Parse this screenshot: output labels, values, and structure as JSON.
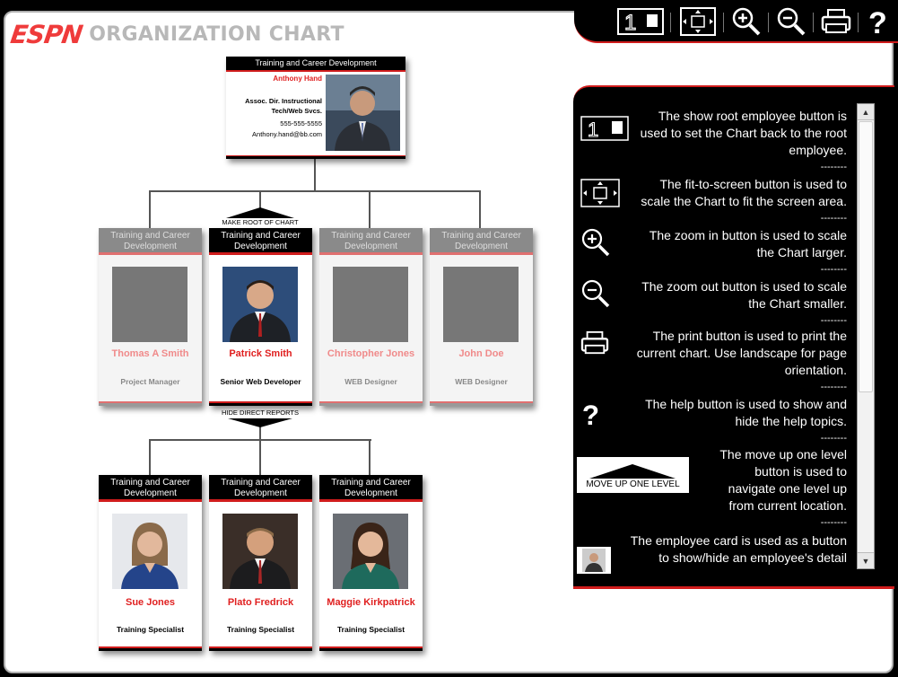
{
  "header": {
    "brand": "ESPN",
    "title": "ORGANIZATION CHART"
  },
  "toolbar": {
    "root_label": "1",
    "tooltips": [
      "Show root employee",
      "Fit to screen",
      "Zoom in",
      "Zoom out",
      "Print",
      "Help"
    ]
  },
  "root_card": {
    "dept": "Training and Career Development",
    "name": "Anthony Hand",
    "title": "Assoc. Dir. Instructional Tech/Web Svcs.",
    "phone": "555-555-5555",
    "email": "Anthony.hand@bb.com"
  },
  "make_root_label": "MAKE ROOT OF CHART",
  "hide_reports_label": "HIDE DIRECT REPORTS",
  "level2": [
    {
      "dept": "Training and Career Development",
      "name": "Thomas A Smith",
      "title": "Project Manager",
      "dim": true
    },
    {
      "dept": "Training and Career Development",
      "name": "Patrick Smith",
      "title": "Senior Web Developer",
      "dim": false
    },
    {
      "dept": "Training and Career Development",
      "name": "Christopher Jones",
      "title": "WEB Designer",
      "dim": true
    },
    {
      "dept": "Training and Career Development",
      "name": "John Doe",
      "title": "WEB Designer",
      "dim": true
    }
  ],
  "level3": [
    {
      "dept": "Training and Career Development",
      "name": "Sue Jones",
      "title": "Training Specialist"
    },
    {
      "dept": "Training and Career Development",
      "name": "Plato Fredrick",
      "title": "Training Specialist"
    },
    {
      "dept": "Training and Career Development",
      "name": "Maggie Kirkpatrick",
      "title": "Training Specialist"
    }
  ],
  "help": {
    "items": [
      {
        "icon": "root-icon",
        "text": "The show root employee button is used to set the Chart back to the root employee."
      },
      {
        "icon": "fit-screen-icon",
        "text": "The fit-to-screen button is used to scale the Chart to fit the screen area."
      },
      {
        "icon": "zoom-in-icon",
        "text": "The zoom in button is used to scale the Chart larger."
      },
      {
        "icon": "zoom-out-icon",
        "text": "The zoom out button is used to scale the Chart smaller."
      },
      {
        "icon": "print-icon",
        "text": "The print button is used to print the current chart. Use landscape for page orientation."
      },
      {
        "icon": "help-icon",
        "text": "The help button is used to show and hide the help topics."
      },
      {
        "icon": "move-up-icon",
        "text": "The move up one level button is used to navigate one level up from current location."
      },
      {
        "icon": "card-icon",
        "text": "The employee card is used as a button to show/hide an employee's detail"
      }
    ],
    "separator": "--------",
    "move_up_label": "MOVE UP ONE LEVEL"
  },
  "colors": {
    "accent": "#d01c1c",
    "name_red": "#e02020",
    "brand_red": "#ef3b3b"
  }
}
